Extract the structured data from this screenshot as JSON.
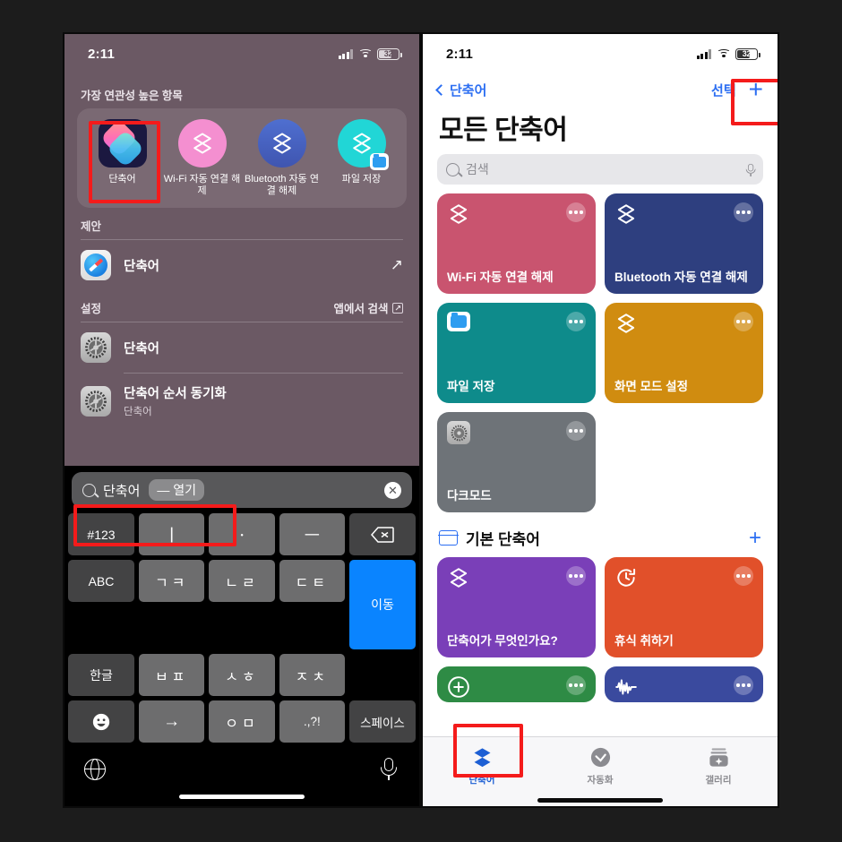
{
  "left_phone": {
    "status": {
      "time": "2:11",
      "battery": "32",
      "signal_icon": "cellular-bars-icon",
      "wifi_icon": "wifi-icon",
      "battery_icon": "battery-icon"
    },
    "top_hits": {
      "section_title": "가장 연관성 높은 항목",
      "apps": [
        {
          "label": "단축어",
          "icon": "shortcuts-app-icon",
          "highlighted": true
        },
        {
          "label": "Wi-Fi 자동 연결 해제",
          "icon": "shortcut-layers-icon",
          "color": "#f48fd0"
        },
        {
          "label": "Bluetooth 자동 연결 해제",
          "icon": "shortcut-layers-icon",
          "color": "#4568c4"
        },
        {
          "label": "파일 저장",
          "icon": "shortcut-layers-icon",
          "color": "#21d6d6",
          "badge": "files-app-badge-icon"
        }
      ]
    },
    "suggestions": {
      "section_title": "제안",
      "items": [
        {
          "title": "단축어",
          "icon": "safari-app-icon",
          "trailing_icon": "arrow-up-right-icon"
        }
      ]
    },
    "settings": {
      "section_title": "설정",
      "action_label": "앱에서 검색",
      "action_icon": "open-in-app-icon",
      "items": [
        {
          "title": "단축어",
          "subtitle": "",
          "icon": "settings-app-icon"
        },
        {
          "title": "단축어 순서 동기화",
          "subtitle": "단축어",
          "icon": "settings-app-icon"
        }
      ]
    },
    "search": {
      "query": "단축어",
      "token": "— 열기",
      "clear_label": "✕",
      "search_icon": "search-icon",
      "clear_icon": "clear-icon",
      "highlighted": true
    },
    "keyboard": {
      "rows": [
        [
          {
            "label": "#123",
            "style": "dark"
          },
          {
            "label": "ㅣ",
            "style": "normal"
          },
          {
            "label": "ㆍ",
            "style": "normal"
          },
          {
            "label": "ㅡ",
            "style": "normal"
          },
          {
            "label": "delete-icon",
            "style": "dark"
          }
        ],
        [
          {
            "label": "ABC",
            "style": "dark"
          },
          {
            "label": "ㄱㅋ",
            "style": "normal"
          },
          {
            "label": "ㄴㄹ",
            "style": "normal"
          },
          {
            "label": "ㄷㅌ",
            "style": "normal"
          },
          {
            "label": "이동",
            "style": "blue"
          }
        ],
        [
          {
            "label": "한글",
            "style": "dark"
          },
          {
            "label": "ㅂㅍ",
            "style": "normal"
          },
          {
            "label": "ㅅㅎ",
            "style": "normal"
          },
          {
            "label": "ㅈㅊ",
            "style": "normal"
          }
        ],
        [
          {
            "label": "emoji-icon",
            "style": "dark"
          },
          {
            "label": "→",
            "style": "normal"
          },
          {
            "label": "ㅇㅁ",
            "style": "normal"
          },
          {
            "label": ".,?!",
            "style": "normal"
          },
          {
            "label": "스페이스",
            "style": "dark"
          }
        ]
      ],
      "globe_icon": "globe-icon",
      "dictation_icon": "microphone-icon"
    }
  },
  "right_phone": {
    "status": {
      "time": "2:11",
      "battery": "32",
      "signal_icon": "cellular-bars-icon",
      "wifi_icon": "wifi-icon",
      "battery_icon": "battery-icon"
    },
    "nav": {
      "back_label": "단축어",
      "back_icon": "chevron-left-icon",
      "select_label": "선택",
      "add_label": "+",
      "add_icon": "plus-icon",
      "add_highlighted": true
    },
    "title": "모든 단축어",
    "search": {
      "placeholder": "검색",
      "search_icon": "search-icon",
      "dictation_icon": "microphone-icon"
    },
    "all_shortcuts": [
      {
        "name": "Wi-Fi 자동 연결 해제",
        "color": "#c9546f",
        "icon": "shortcut-layers-icon",
        "menu_icon": "ellipsis-icon"
      },
      {
        "name": "Bluetooth 자동 연결 해제",
        "color": "#2e3f7f",
        "icon": "shortcut-layers-icon",
        "menu_icon": "ellipsis-icon"
      },
      {
        "name": "파일 저장",
        "color": "#0e8b8b",
        "icon": "files-folder-icon",
        "menu_icon": "ellipsis-icon"
      },
      {
        "name": "화면 모드 설정",
        "color": "#d08c10",
        "icon": "shortcut-layers-icon",
        "menu_icon": "ellipsis-icon"
      },
      {
        "name": "다크모드",
        "color": "#6e7378",
        "icon": "settings-gear-icon",
        "menu_icon": "ellipsis-icon"
      }
    ],
    "folder": {
      "title": "기본 단축어",
      "folder_icon": "folder-icon",
      "add_icon": "plus-icon",
      "add_label": "+",
      "shortcuts": [
        {
          "name": "단축어가 무엇인가요?",
          "color": "#7a3fb8",
          "icon": "shortcut-layers-icon",
          "menu_icon": "ellipsis-icon"
        },
        {
          "name": "휴식 취하기",
          "color": "#e1502a",
          "icon": "timer-icon",
          "menu_icon": "ellipsis-icon"
        },
        {
          "name": "",
          "color": "#2e8b45",
          "icon": "plus-circle-icon",
          "menu_icon": "ellipsis-icon"
        },
        {
          "name": "",
          "color": "#3a4a9e",
          "icon": "waveform-icon",
          "menu_icon": "ellipsis-icon"
        }
      ]
    },
    "tabs": [
      {
        "label": "단축어",
        "icon": "shortcuts-layers-tab-icon",
        "active": true,
        "highlighted": true
      },
      {
        "label": "자동화",
        "icon": "automation-clock-icon",
        "active": false
      },
      {
        "label": "갤러리",
        "icon": "gallery-sparkle-icon",
        "active": false
      }
    ]
  },
  "colors": {
    "highlight_red": "#f41b1b",
    "ios_blue": "#2b6ef2",
    "keyboard_blue": "#0a84ff"
  }
}
